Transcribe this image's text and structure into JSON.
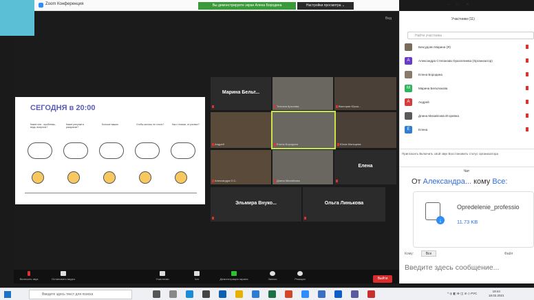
{
  "window": {
    "title": "Zoom Конференция",
    "share_banner": "Вы демонстрируете экран Алена Бородина",
    "view_options": "Настройки просмотра ⌄",
    "view_label": "Вид"
  },
  "slide": {
    "title": "СЕГОДНЯ в 20:00",
    "questions": [
      "Какие они - проблемы, ведь, вопросы?",
      "Какие рисунки в раскраске?",
      "Больше ваших",
      "Чтобы жилось не стало?",
      "Как с новым, от разных?"
    ]
  },
  "video": {
    "tiles": [
      {
        "name": "Марина  Бельт...",
        "big": true
      },
      {
        "name": "Татьяна Крылова",
        "big": false
      },
      {
        "name": "Виктория Юрья...",
        "big": false
      },
      {
        "name": "Андрей",
        "big": false
      },
      {
        "name": "Елена Бородина",
        "big": false
      },
      {
        "name": "Юлия Мальцева",
        "big": false
      },
      {
        "name": "Александра О.С.",
        "big": false
      },
      {
        "name": "Длина Михайлова",
        "big": false
      },
      {
        "name": "Елена",
        "big": true
      },
      {
        "name": "Эльмира  Внуко...",
        "big": true
      },
      {
        "name": "Ольга  Линькова",
        "big": true
      }
    ]
  },
  "toolbar": {
    "mute": "Включить звук",
    "video": "Остановить видео",
    "participants": "Участники",
    "chat": "Чат",
    "share": "Демонстрация экрана",
    "record": "Запись",
    "reactions": "Реакции",
    "end": "Выйти"
  },
  "participants": {
    "title": "Участники (11)",
    "search_placeholder": "Найти участника",
    "list": [
      {
        "name": "Безсудоян Марина (Я)",
        "initial": "",
        "color": "#7a6a5a"
      },
      {
        "name": "Александра Степанова Оразгелиева (Организатор)",
        "initial": "А",
        "color": "#6a3bc4"
      },
      {
        "name": "Елена Бородина",
        "initial": "",
        "color": "#8a7a6a"
      },
      {
        "name": "Марина Бельтюкова",
        "initial": "М",
        "color": "#2fb55a"
      },
      {
        "name": "Андрей",
        "initial": "А",
        "color": "#d63b3b"
      },
      {
        "name": "Длина Михайлова Игоревна",
        "initial": "",
        "color": "#5a5a5a"
      },
      {
        "name": "Елена",
        "initial": "Е",
        "color": "#2d7fd6"
      }
    ],
    "footer": "Пригласить   Включить свой звук   Восстановить статус организатора"
  },
  "chat": {
    "title": "Чат",
    "from_prefix": "От",
    "from_name": "Александра...",
    "to_prefix": "кому",
    "to_name": "Все:",
    "file_name": "Opredelenie_professio",
    "file_size": "11.73 KB",
    "to_label": "Кому:",
    "to_select": "Все",
    "file_button": "Файл",
    "input_placeholder": "Введите здесь сообщение..."
  },
  "taskbar": {
    "search_placeholder": "Введите здесь текст для поиска",
    "tray": "^ ◎ ◧ ⊕ ◫ ⊘ ◇ РУС",
    "time": "19:44",
    "date": "18.02.2021"
  }
}
